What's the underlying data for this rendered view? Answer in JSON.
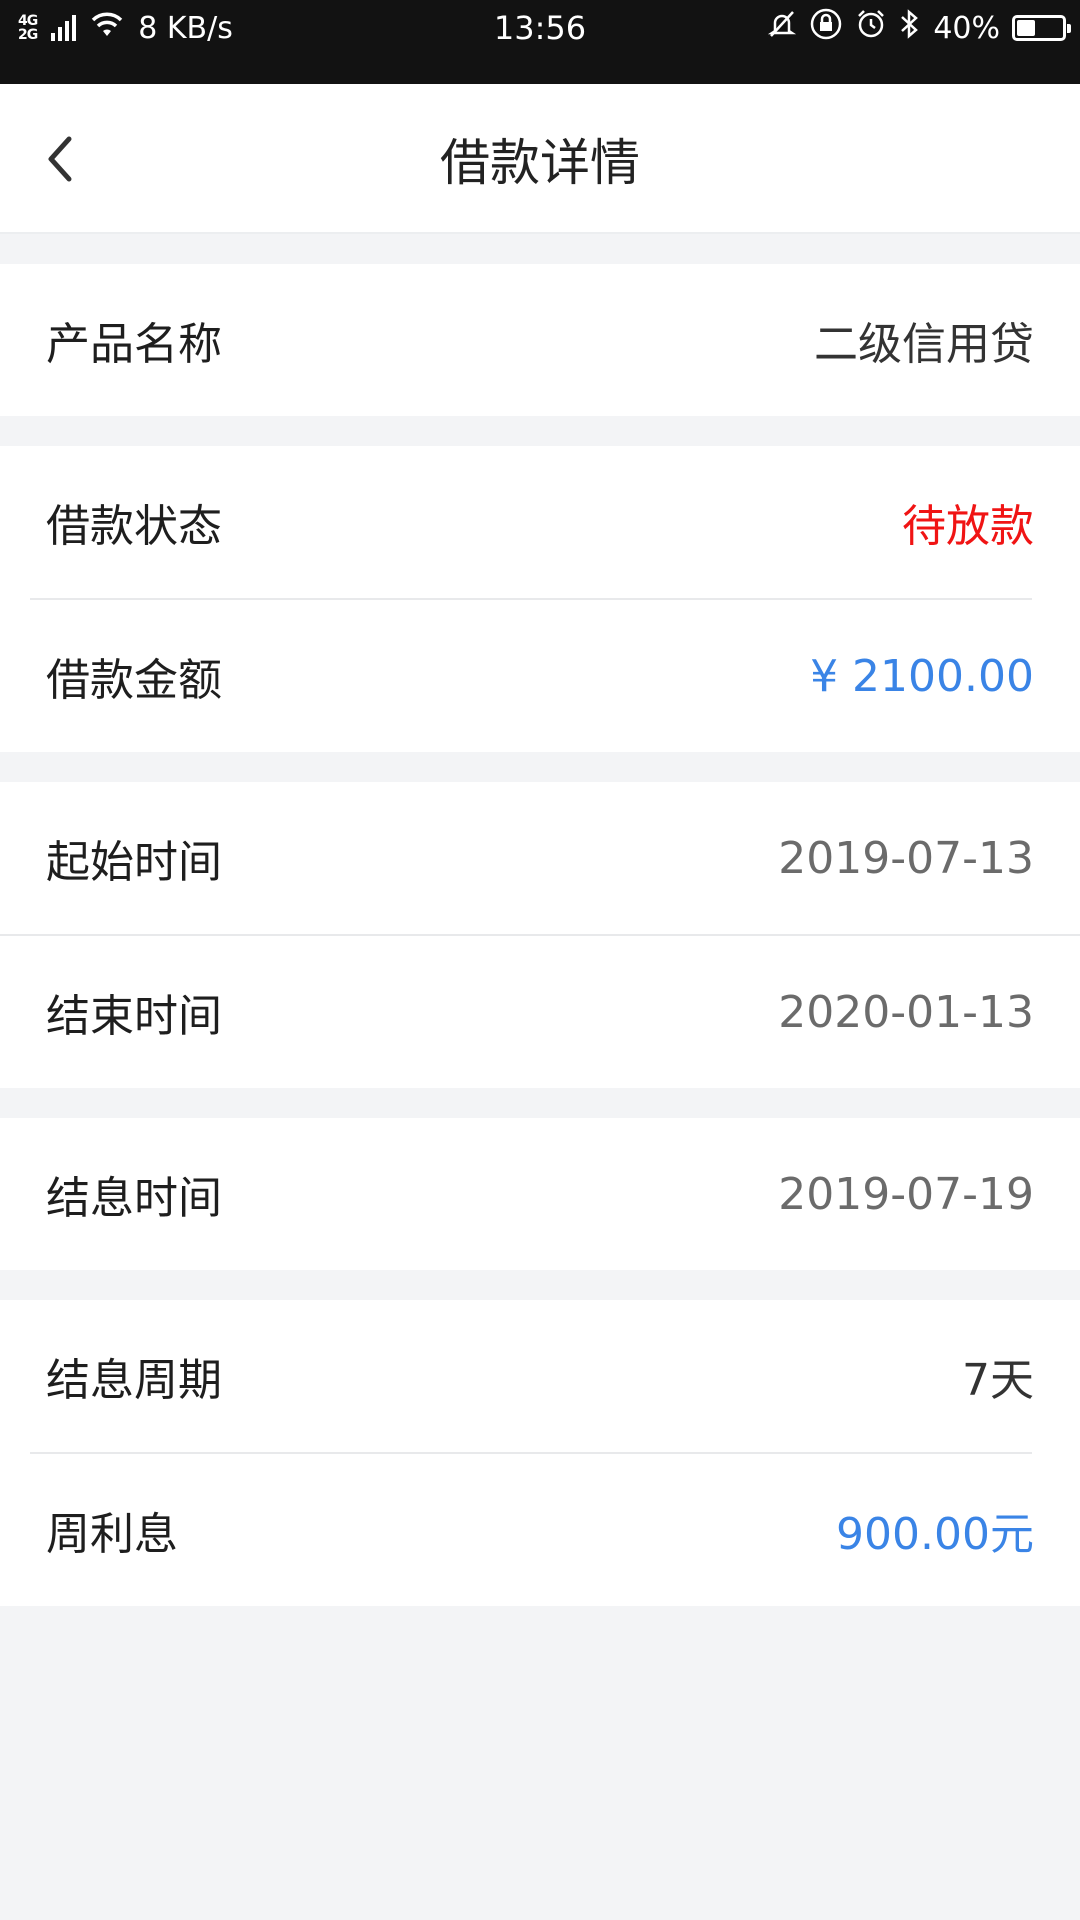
{
  "status_bar": {
    "network_top": "4G",
    "network_bottom": "2G",
    "speed": "8 KB/s",
    "time": "13:56",
    "battery": "40%",
    "battery_level": 0.4
  },
  "header": {
    "title": "借款详情"
  },
  "groups": [
    {
      "rows": [
        {
          "label": "产品名称",
          "value": "二级信用贷"
        }
      ]
    },
    {
      "rows": [
        {
          "label": "借款状态",
          "value": "待放款"
        },
        {
          "label": "借款金额",
          "value": "¥ 2100.00"
        }
      ]
    },
    {
      "rows": [
        {
          "label": "起始时间",
          "value": "2019-07-13"
        },
        {
          "label": "结束时间",
          "value": "2020-01-13"
        }
      ]
    },
    {
      "rows": [
        {
          "label": "结息时间",
          "value": "2019-07-19"
        }
      ]
    },
    {
      "rows": [
        {
          "label": "结息周期",
          "value": "7天"
        },
        {
          "label": "周利息",
          "value": "900.00元"
        }
      ]
    }
  ],
  "colors": {
    "status_pending": "#f01414",
    "amount_blue": "#3a84e6"
  }
}
